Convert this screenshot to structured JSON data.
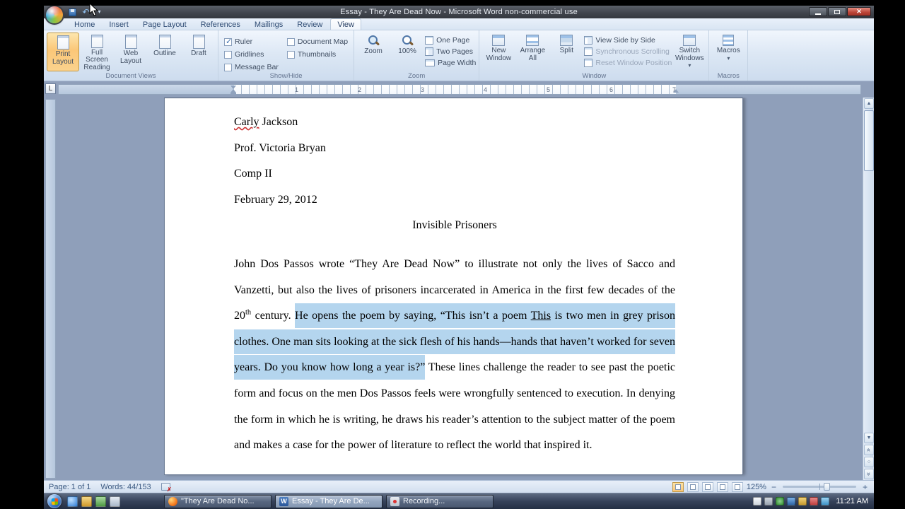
{
  "window": {
    "title": "Essay - They Are Dead Now - Microsoft Word non-commercial use"
  },
  "colors": {
    "selection_highlight": "#b4d5ee",
    "selected_button_orange": "#fbc778",
    "desktop_background": "#8f9fba"
  },
  "ribbon": {
    "tabs": [
      "Home",
      "Insert",
      "Page Layout",
      "References",
      "Mailings",
      "Review",
      "View"
    ],
    "active_tab": "View",
    "groups": {
      "document_views": {
        "label": "Document Views",
        "buttons": [
          "Print Layout",
          "Full Screen Reading",
          "Web Layout",
          "Outline",
          "Draft"
        ],
        "selected": "Print Layout"
      },
      "show_hide": {
        "label": "Show/Hide",
        "checkboxes": [
          {
            "label": "Ruler",
            "checked": true
          },
          {
            "label": "Gridlines",
            "checked": false
          },
          {
            "label": "Message Bar",
            "checked": false
          },
          {
            "label": "Document Map",
            "checked": false
          },
          {
            "label": "Thumbnails",
            "checked": false
          }
        ]
      },
      "zoom": {
        "label": "Zoom",
        "buttons": [
          "Zoom",
          "100%",
          "One Page",
          "Two Pages",
          "Page Width"
        ]
      },
      "window": {
        "label": "Window",
        "buttons": [
          "New Window",
          "Arrange All",
          "Split",
          "View Side by Side",
          "Synchronous Scrolling",
          "Reset Window Position",
          "Switch Windows"
        ]
      },
      "macros": {
        "label": "Macros",
        "buttons": [
          "Macros"
        ]
      }
    }
  },
  "ruler": {
    "tab_selector": "L",
    "numbers": [
      "1",
      "2",
      "3",
      "4",
      "5",
      "6",
      "7"
    ]
  },
  "document": {
    "header_lines": [
      {
        "segments": [
          {
            "text": "Carly",
            "style": "spellcheck"
          },
          {
            "text": " Jackson",
            "style": "normal"
          }
        ]
      },
      {
        "segments": [
          {
            "text": "Prof. Victoria Bryan",
            "style": "normal"
          }
        ]
      },
      {
        "segments": [
          {
            "text": "Comp II",
            "style": "normal"
          }
        ]
      },
      {
        "segments": [
          {
            "text": "February 29, 2012",
            "style": "normal"
          }
        ]
      }
    ],
    "title": "Invisible Prisoners",
    "paragraph_segments": [
      {
        "text": "John Dos Passos wrote “They Are Dead Now” to illustrate not only the lives of Sacco and Vanzetti, but also the lives of prisoners incarcerated in America in the first few decades of the 20",
        "style": "normal"
      },
      {
        "text": "th",
        "style": "sup"
      },
      {
        "text": " century. ",
        "style": "normal"
      },
      {
        "text": "He opens the poem by saying, “This isn’t a poem ",
        "style": "highlight"
      },
      {
        "text": "This",
        "style": "highlight_underline"
      },
      {
        "text": " is two men in grey prison clothes. One man sits looking at the sick flesh of his hands—hands that haven’t worked for seven years. Do you know how long a year is?”",
        "style": "highlight"
      },
      {
        "text": " These lines challenge the reader to see past the poetic form and focus on the men Dos Passos feels were wrongfully sentenced to execution. In denying the form in which he is writing, he draws his reader’s attention to the subject matter of the poem and makes a case for the power of literature to reflect the world that inspired it.",
        "style": "normal"
      }
    ]
  },
  "status_bar": {
    "page": "Page: 1 of 1",
    "words": "Words: 44/153",
    "zoom": "125%"
  },
  "taskbar": {
    "quick_launch": [
      "internet-explorer-icon",
      "media-player-icon",
      "show-desktop-icon",
      "explorer-icon"
    ],
    "buttons": [
      {
        "label": "\"They Are Dead No...",
        "icon": "firefox",
        "active": false
      },
      {
        "label": "Essay - They Are De...",
        "icon": "word",
        "active": true
      },
      {
        "label": "Recording...",
        "icon": "recorder",
        "active": false
      }
    ],
    "tray_icons": [
      "hidden-icons-button",
      "safely-remove-hardware-icon",
      "antivirus-icon",
      "network-icon",
      "update-icon",
      "messenger-icon",
      "volume-icon"
    ],
    "clock": "11:21 AM"
  }
}
